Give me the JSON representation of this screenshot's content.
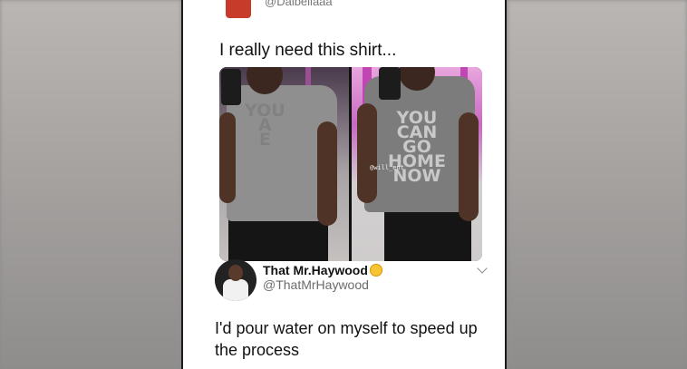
{
  "post": {
    "top_handle": "@Daibellaaa",
    "text": "I really need this shirt...",
    "shirt_left_text": [
      "YOU",
      "A",
      "E"
    ],
    "shirt_right_text": [
      "YOU",
      "CAN",
      "GO",
      "HOME",
      "NOW"
    ],
    "watermark": "@will_ent"
  },
  "reply": {
    "name": "That Mr.Haywood",
    "handle": "@ThatMrHaywood",
    "body": "I'd pour water on myself to speed up the process"
  }
}
